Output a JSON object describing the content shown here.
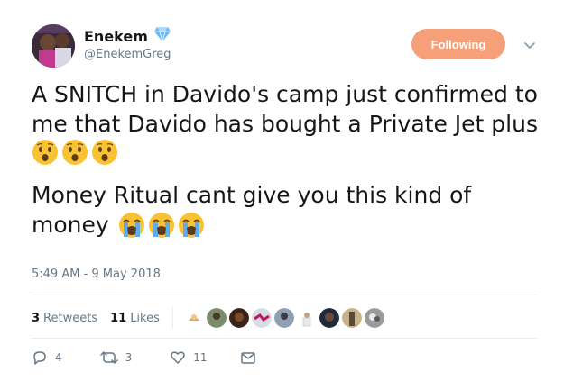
{
  "user": {
    "display_name": "Enekem",
    "handle": "@EnekemGreg",
    "verified_icon": "diamond-icon"
  },
  "follow_button": {
    "label": "Following"
  },
  "tweet": {
    "line1": "A SNITCH in Davido's camp just confirmed to",
    "line2": "me that Davido has bought a Private Jet plus",
    "line3_emojis": "hushed-face-emoji x3",
    "line4": "Money Ritual cant give you this kind of",
    "line5": "money",
    "line5_emojis": "loudly-crying-face-emoji x3"
  },
  "timestamp": "5:49 AM - 9 May 2018",
  "stats": {
    "retweets_count": "3",
    "retweets_label": "Retweets",
    "likes_count": "11",
    "likes_label": "Likes"
  },
  "actions": {
    "reply_count": "4",
    "retweet_count": "3",
    "like_count": "11"
  },
  "colors": {
    "follow_button": "#f6a07a",
    "secondary_text": "#657786",
    "divider": "#e6ecf0",
    "verified": "#6ab7f5"
  }
}
